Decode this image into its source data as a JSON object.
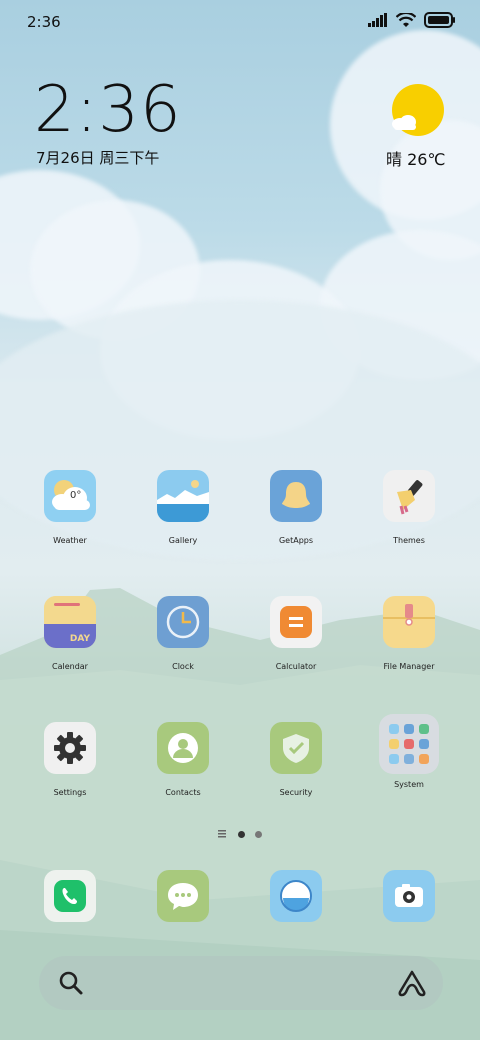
{
  "status_bar": {
    "time": "2:36"
  },
  "clock_widget": {
    "time": "2:36",
    "date": "7月26日 周三下午"
  },
  "weather_widget": {
    "condition_temp": "晴 26℃"
  },
  "apps": [
    {
      "label": "Weather",
      "icon": "weather-icon",
      "badge": "0°"
    },
    {
      "label": "Gallery",
      "icon": "gallery-icon"
    },
    {
      "label": "GetApps",
      "icon": "getapps-icon"
    },
    {
      "label": "Themes",
      "icon": "themes-icon"
    },
    {
      "label": "Calendar",
      "icon": "calendar-icon",
      "badge": "DAY"
    },
    {
      "label": "Clock",
      "icon": "clock-icon"
    },
    {
      "label": "Calculator",
      "icon": "calculator-icon"
    },
    {
      "label": "File Manager",
      "icon": "file-manager-icon"
    },
    {
      "label": "Settings",
      "icon": "settings-icon"
    },
    {
      "label": "Contacts",
      "icon": "contacts-icon"
    },
    {
      "label": "Security",
      "icon": "security-icon"
    },
    {
      "label": "System",
      "icon": "system-folder-icon"
    }
  ],
  "dock": [
    {
      "icon": "phone-icon"
    },
    {
      "icon": "messages-icon"
    },
    {
      "icon": "browser-icon"
    },
    {
      "icon": "camera-icon"
    }
  ],
  "pager": {
    "pages": 2,
    "active": 0
  },
  "colors": {
    "sun": "#f8cf00",
    "accent_green": "#a8c97d"
  }
}
